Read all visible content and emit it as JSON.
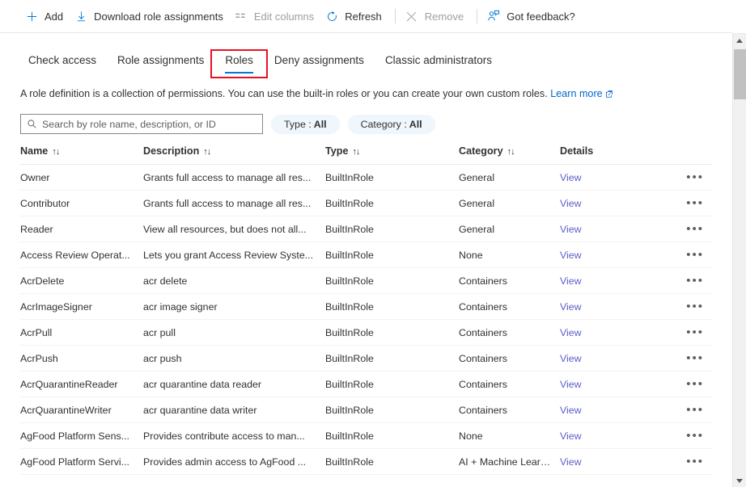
{
  "toolbar": {
    "items": [
      {
        "label": "Add",
        "icon": "plus-icon",
        "disabled": false
      },
      {
        "label": "Download role assignments",
        "icon": "download-icon",
        "disabled": false
      },
      {
        "label": "Edit columns",
        "icon": "columns-icon",
        "disabled": true
      },
      {
        "label": "Refresh",
        "icon": "refresh-icon",
        "disabled": false
      },
      {
        "label": "Remove",
        "icon": "close-icon",
        "disabled": true
      },
      {
        "label": "Got feedback?",
        "icon": "feedback-icon",
        "disabled": false
      }
    ]
  },
  "tabs": [
    {
      "label": "Check access",
      "selected": false,
      "highlighted": false
    },
    {
      "label": "Role assignments",
      "selected": false,
      "highlighted": false
    },
    {
      "label": "Roles",
      "selected": true,
      "highlighted": true
    },
    {
      "label": "Deny assignments",
      "selected": false,
      "highlighted": false
    },
    {
      "label": "Classic administrators",
      "selected": false,
      "highlighted": false
    }
  ],
  "description": {
    "text": "A role definition is a collection of permissions. You can use the built-in roles or you can create your own custom roles.",
    "link_label": "Learn more"
  },
  "filters": {
    "search": {
      "placeholder": "Search by role name, description, or ID",
      "value": ""
    },
    "pills": [
      {
        "label": "Type :",
        "value": "All"
      },
      {
        "label": "Category :",
        "value": "All"
      }
    ]
  },
  "table": {
    "columns": [
      {
        "label": "Name",
        "sortable": true
      },
      {
        "label": "Description",
        "sortable": true
      },
      {
        "label": "Type",
        "sortable": true
      },
      {
        "label": "Category",
        "sortable": true
      },
      {
        "label": "Details",
        "sortable": false
      }
    ],
    "details_link_label": "View",
    "row_menu_glyph": "•••",
    "rows": [
      {
        "name": "Owner",
        "description": "Grants full access to manage all res...",
        "type": "BuiltInRole",
        "category": "General"
      },
      {
        "name": "Contributor",
        "description": "Grants full access to manage all res...",
        "type": "BuiltInRole",
        "category": "General"
      },
      {
        "name": "Reader",
        "description": "View all resources, but does not all...",
        "type": "BuiltInRole",
        "category": "General"
      },
      {
        "name": "Access Review Operat...",
        "description": "Lets you grant Access Review Syste...",
        "type": "BuiltInRole",
        "category": "None"
      },
      {
        "name": "AcrDelete",
        "description": "acr delete",
        "type": "BuiltInRole",
        "category": "Containers"
      },
      {
        "name": "AcrImageSigner",
        "description": "acr image signer",
        "type": "BuiltInRole",
        "category": "Containers"
      },
      {
        "name": "AcrPull",
        "description": "acr pull",
        "type": "BuiltInRole",
        "category": "Containers"
      },
      {
        "name": "AcrPush",
        "description": "acr push",
        "type": "BuiltInRole",
        "category": "Containers"
      },
      {
        "name": "AcrQuarantineReader",
        "description": "acr quarantine data reader",
        "type": "BuiltInRole",
        "category": "Containers"
      },
      {
        "name": "AcrQuarantineWriter",
        "description": "acr quarantine data writer",
        "type": "BuiltInRole",
        "category": "Containers"
      },
      {
        "name": "AgFood Platform Sens...",
        "description": "Provides contribute access to man...",
        "type": "BuiltInRole",
        "category": "None"
      },
      {
        "name": "AgFood Platform Servi...",
        "description": "Provides admin access to AgFood ...",
        "type": "BuiltInRole",
        "category": "AI + Machine Learning"
      }
    ]
  },
  "colors": {
    "accent": "#0078d4",
    "link": "#0066cc",
    "view_link": "#5b5fc7",
    "pill_bg": "#eff6fc",
    "highlight_outline": "#e81123",
    "disabled_text": "#a19f9d"
  }
}
